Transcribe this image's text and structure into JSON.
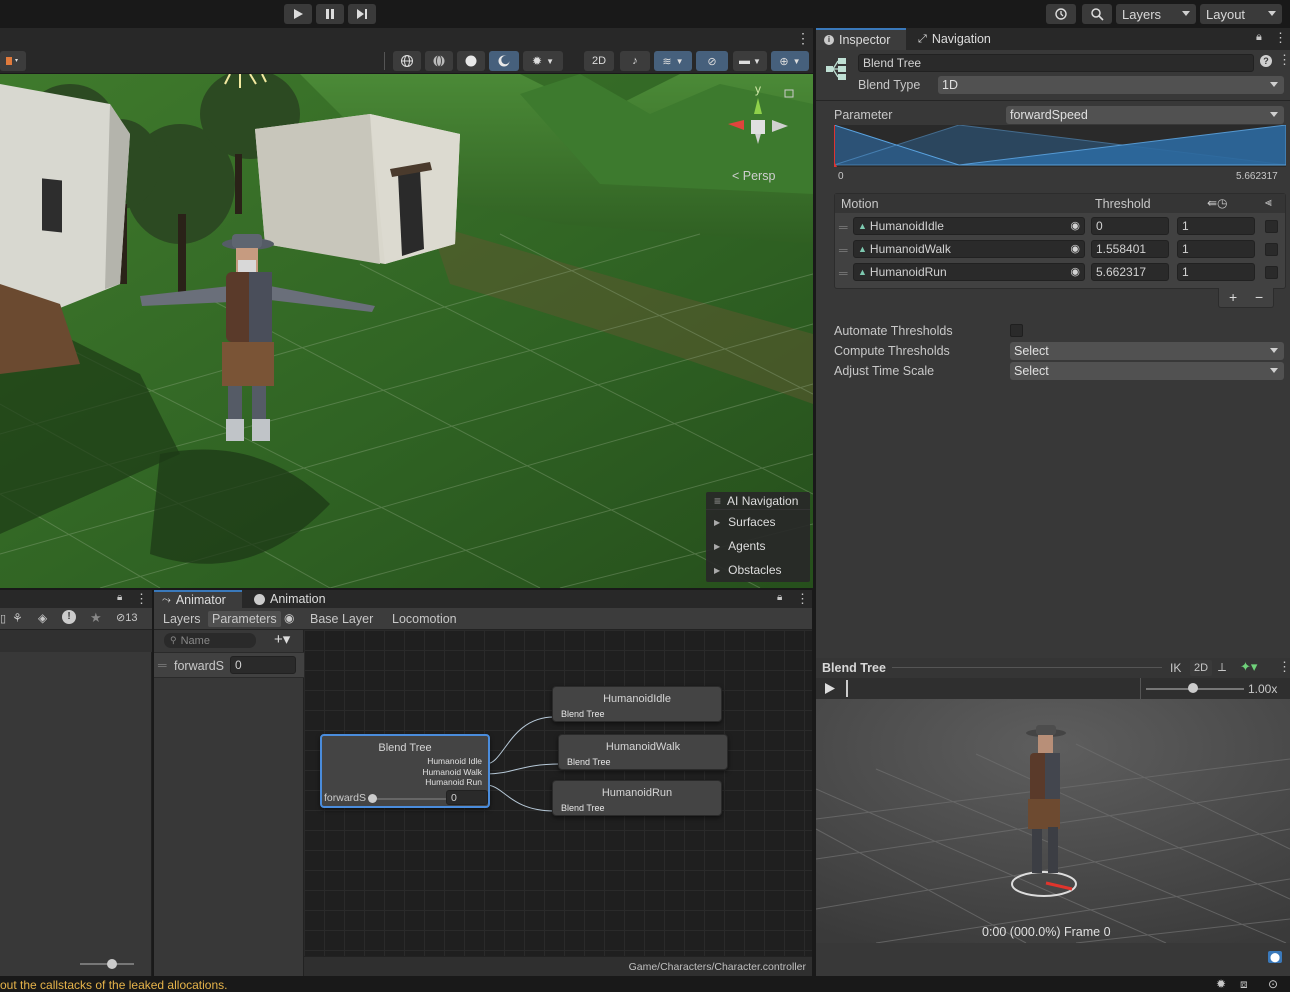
{
  "toolbar": {
    "layers_label": "Layers",
    "layout_label": "Layout"
  },
  "scene": {
    "toolbar": {
      "mode_2d": "2D"
    },
    "persp_label": "< Persp",
    "gizmo_y": "y",
    "ai_nav": {
      "title": "AI Navigation",
      "items": [
        "Surfaces",
        "Agents",
        "Obstacles"
      ]
    }
  },
  "inspector": {
    "tabs": [
      "Inspector",
      "Navigation"
    ],
    "name_value": "Blend Tree",
    "blend_type_label": "Blend Type",
    "blend_type_value": "1D",
    "parameter_label": "Parameter",
    "parameter_value": "forwardSpeed",
    "graph_min": "0",
    "graph_max": "5.662317",
    "motion_header": "Motion",
    "threshold_header": "Threshold",
    "motions": [
      {
        "name": "HumanoidIdle",
        "threshold": "0",
        "speed": "1"
      },
      {
        "name": "HumanoidWalk",
        "threshold": "1.558401",
        "speed": "1"
      },
      {
        "name": "HumanoidRun",
        "threshold": "5.662317",
        "speed": "1"
      }
    ],
    "add_label": "+",
    "remove_label": "−",
    "automate_label": "Automate Thresholds",
    "compute_label": "Compute Thresholds",
    "compute_value": "Select",
    "adjust_label": "Adjust Time Scale",
    "adjust_value": "Select"
  },
  "preview": {
    "title": "Blend Tree",
    "ik_label": "IK",
    "mode_2d": "2D",
    "speed_value": "1.00x",
    "time_readout": "0:00 (000.0%) Frame 0"
  },
  "left_panel": {
    "hidden_count": "13"
  },
  "animator": {
    "tabs": [
      "Animator",
      "Animation"
    ],
    "subtabs": [
      "Layers",
      "Parameters"
    ],
    "breadcrumb": [
      "Base Layer",
      "Locomotion"
    ],
    "search_placeholder": "Name",
    "param_name": "forwardS",
    "param_value": "0",
    "blend_node": {
      "title": "Blend Tree",
      "outputs": [
        "Humanoid Idle",
        "Humanoid Walk",
        "Humanoid Run"
      ],
      "param_label": "forwardS",
      "param_value": "0"
    },
    "nodes": [
      {
        "title": "HumanoidIdle",
        "sub": "Blend Tree"
      },
      {
        "title": "HumanoidWalk",
        "sub": "Blend Tree"
      },
      {
        "title": "HumanoidRun",
        "sub": "Blend Tree"
      }
    ],
    "path": "Game/Characters/Character.controller"
  },
  "status": {
    "message": "out the callstacks of the leaked allocations."
  }
}
